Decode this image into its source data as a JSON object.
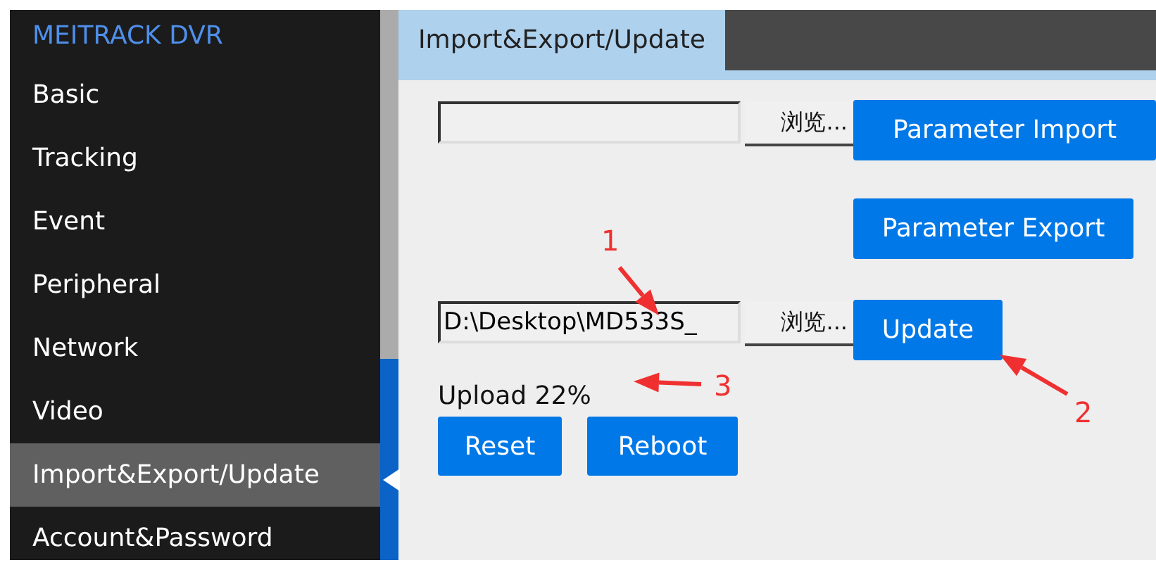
{
  "sidebar": {
    "title": "MEITRACK DVR",
    "items": [
      {
        "label": "Basic",
        "selected": false
      },
      {
        "label": "Tracking",
        "selected": false
      },
      {
        "label": "Event",
        "selected": false
      },
      {
        "label": "Peripheral",
        "selected": false
      },
      {
        "label": "Network",
        "selected": false
      },
      {
        "label": "Video",
        "selected": false
      },
      {
        "label": "Import&Export/Update",
        "selected": true
      },
      {
        "label": "Account&Password",
        "selected": false
      }
    ]
  },
  "tabs": [
    {
      "label": "Import&Export/Update",
      "selected": true
    }
  ],
  "parameter_file": {
    "browse": "浏览...",
    "import_button": "Parameter Import"
  },
  "export_button": "Parameter Export",
  "update_file": {
    "value": "D:\\Desktop\\MD533S_",
    "browse": "浏览...",
    "update_button": "Update"
  },
  "status": "Upload 22%",
  "buttons": [
    "Reset",
    "Reboot"
  ],
  "annotations": [
    "1",
    "2",
    "3"
  ]
}
